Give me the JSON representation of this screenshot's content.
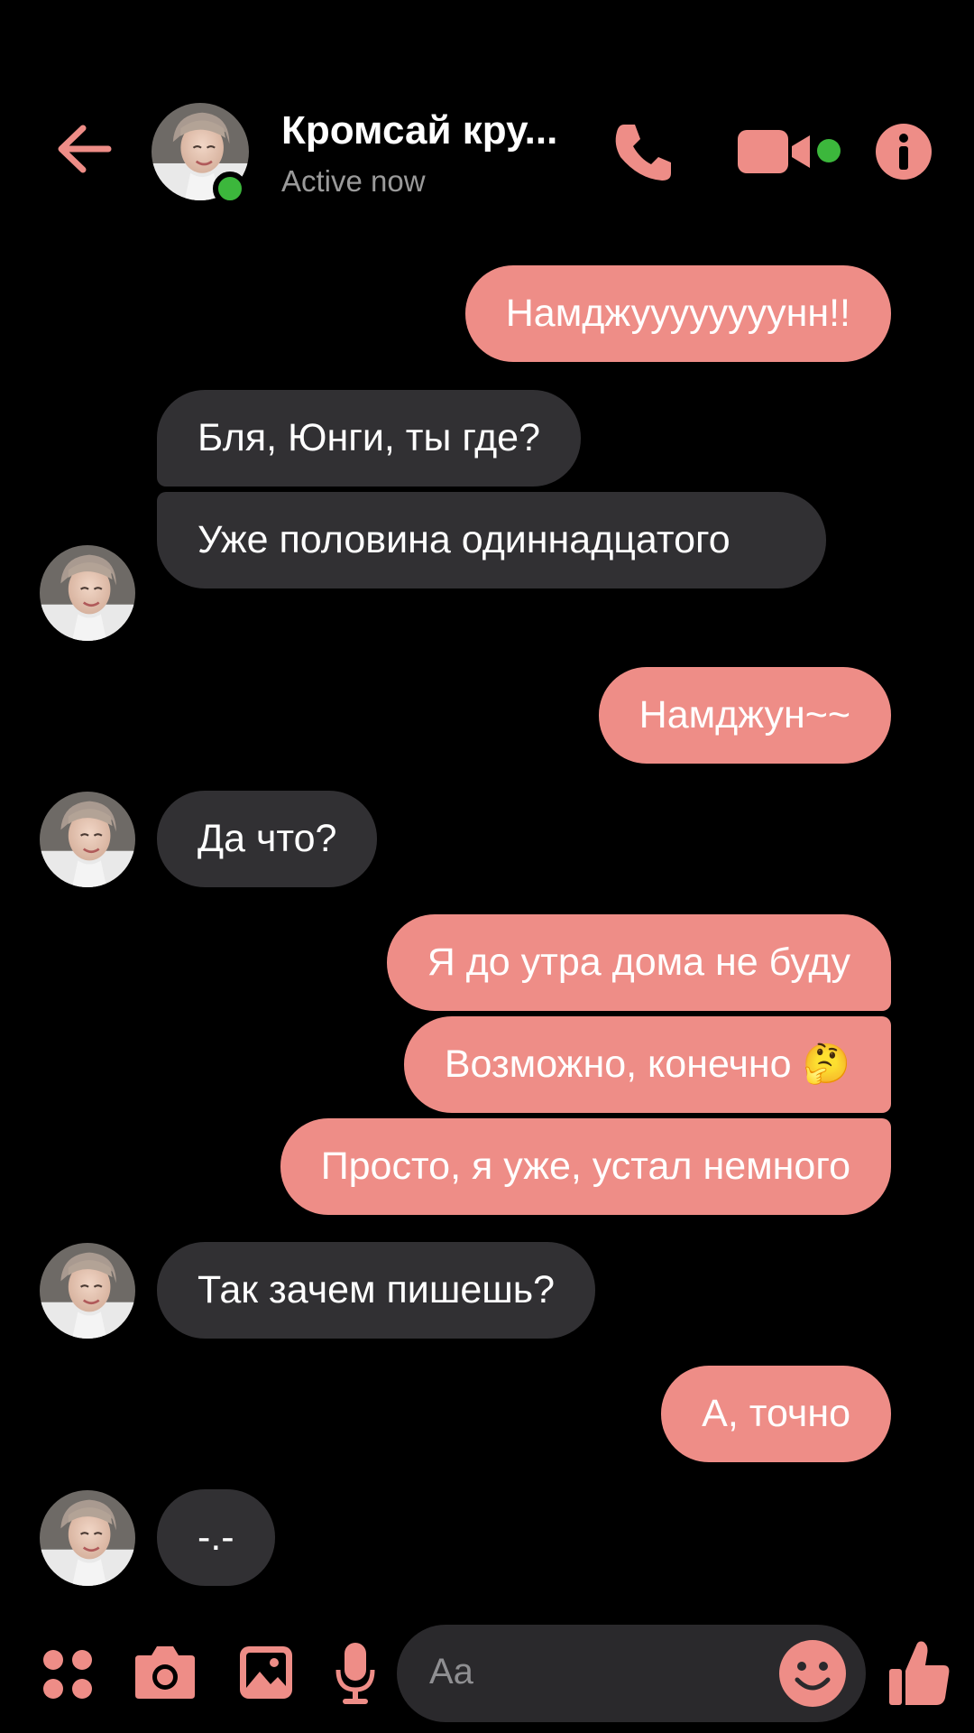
{
  "header": {
    "back_icon": "arrow-left-icon",
    "contact_name": "Кромсай кру...",
    "status": "Active now",
    "actions": [
      "phone-icon",
      "video-camera-icon",
      "info-icon"
    ]
  },
  "accent_color": "#ee8d87",
  "online_color": "#3cb73c",
  "messages": [
    {
      "from": "me",
      "text": "Намджуууууууунн!!"
    },
    {
      "from": "contact",
      "text": "Бля, Юнги, ты где?"
    },
    {
      "from": "contact",
      "text": "Уже половина одиннадцатого"
    },
    {
      "from": "me",
      "text": "Намджун~~"
    },
    {
      "from": "contact",
      "text": "Да что?"
    },
    {
      "from": "me",
      "text": "Я до утра дома не буду"
    },
    {
      "from": "me",
      "text": "Возможно, конечно 🤔"
    },
    {
      "from": "me",
      "text": "Просто, я уже, устал немного"
    },
    {
      "from": "contact",
      "text": "Так зачем пишешь?"
    },
    {
      "from": "me",
      "text": "А, точно"
    },
    {
      "from": "contact",
      "text": "-.-"
    }
  ],
  "composer": {
    "tools": [
      "apps-icon",
      "camera-icon",
      "gallery-icon",
      "microphone-icon"
    ],
    "placeholder": "Aa",
    "emoji_icon": "smiley-icon",
    "send_icon": "thumbs-up-icon"
  }
}
